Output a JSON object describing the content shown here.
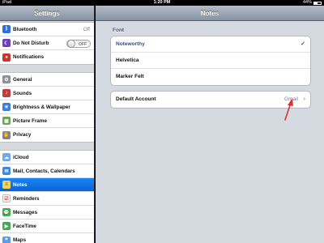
{
  "statusbar": {
    "carrier": "iPad",
    "time": "1:20 PM",
    "battery": "44%"
  },
  "sidebar": {
    "title": "Settings",
    "groups": [
      [
        {
          "label": "Bluetooth",
          "value": "Off",
          "icon": "bluetooth-icon"
        },
        {
          "label": "Do Not Disturb",
          "toggle": "OFF",
          "icon": "moon-icon"
        },
        {
          "label": "Notifications",
          "icon": "notifications-icon"
        }
      ],
      [
        {
          "label": "General",
          "icon": "gear-icon"
        },
        {
          "label": "Sounds",
          "icon": "speaker-icon"
        },
        {
          "label": "Brightness & Wallpaper",
          "icon": "brightness-icon"
        },
        {
          "label": "Picture Frame",
          "icon": "picture-frame-icon"
        },
        {
          "label": "Privacy",
          "icon": "hand-icon"
        }
      ],
      [
        {
          "label": "iCloud",
          "icon": "cloud-icon"
        },
        {
          "label": "Mail, Contacts, Calendars",
          "icon": "mail-icon"
        },
        {
          "label": "Notes",
          "icon": "notes-icon",
          "selected": true
        },
        {
          "label": "Reminders",
          "icon": "reminders-icon"
        },
        {
          "label": "Messages",
          "icon": "messages-icon"
        },
        {
          "label": "FaceTime",
          "icon": "facetime-icon"
        },
        {
          "label": "Maps",
          "icon": "maps-icon"
        }
      ]
    ]
  },
  "detail": {
    "title": "Notes",
    "font_section_label": "Font",
    "fonts": [
      "Noteworthy",
      "Helvetica",
      "Marker Felt"
    ],
    "selected_font": "Noteworthy",
    "default_account": {
      "label": "Default Account",
      "value": "Gmail"
    }
  },
  "colors": {
    "selection": "#0a62d6",
    "annotation_arrow": "#e03030"
  }
}
